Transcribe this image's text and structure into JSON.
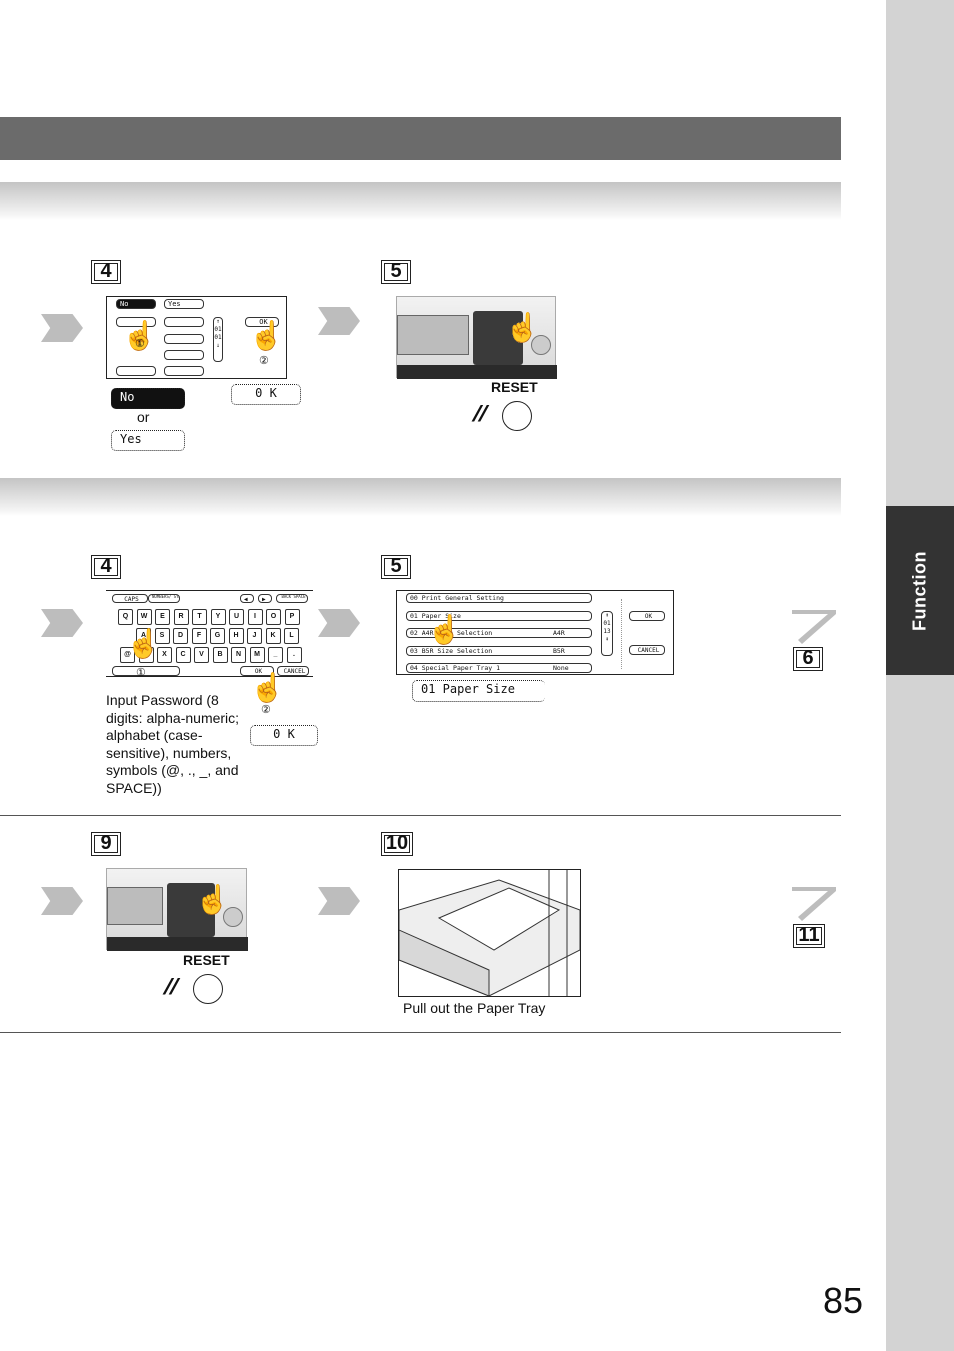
{
  "sidebar": {
    "tab_label": "Function"
  },
  "page_number": "85",
  "section1": {
    "step_a": "4",
    "step_b": "5",
    "screen": {
      "no": "No",
      "yes": "Yes",
      "ok": "OK",
      "counter_top": "01",
      "counter_bottom": "01"
    },
    "no_button": "No",
    "or_label": "or",
    "yes_button": "Yes",
    "ok_button": "0 K",
    "reset_label": "RESET",
    "callout1": "①",
    "callout2": "②"
  },
  "section2": {
    "step_a": "4",
    "step_b": "5",
    "next_step": "6",
    "keyboard": {
      "caps": "CAPS",
      "numbers": "NUMBERS/ SYMBOLS",
      "left": "◀",
      "right": "▶",
      "backspace": "BACK SPACE",
      "row1": [
        "Q",
        "W",
        "E",
        "R",
        "T",
        "Y",
        "U",
        "I",
        "O",
        "P"
      ],
      "row2": [
        "A",
        "S",
        "D",
        "F",
        "G",
        "H",
        "J",
        "K",
        "L"
      ],
      "row3": [
        "@",
        "Z",
        "X",
        "C",
        "V",
        "B",
        "N",
        "M",
        "_",
        "."
      ],
      "ok": "OK",
      "cancel": "CANCEL"
    },
    "instructions": "Input Password (8 digits: alpha-numeric; alphabet (case-sensitive), numbers, symbols (@, ., _, and SPACE))",
    "ok_button": "0 K",
    "list": {
      "items": [
        {
          "label": "00  Print General Setting",
          "value": ""
        },
        {
          "label": "01  Paper Size",
          "value": ""
        },
        {
          "label": "02  A4R Size Selection",
          "value": "A4R"
        },
        {
          "label": "03  B5R Size Selection",
          "value": "B5R"
        },
        {
          "label": "04  Special Paper Tray 1",
          "value": "None"
        }
      ],
      "counter_top": "01",
      "counter_bottom": "13",
      "ok": "OK",
      "cancel": "CANCEL"
    },
    "selected_item": "01  Paper Size"
  },
  "section3": {
    "step_a": "9",
    "step_b": "10",
    "next_step": "11",
    "reset_label": "RESET",
    "tray_caption": "Pull out the Paper Tray"
  }
}
